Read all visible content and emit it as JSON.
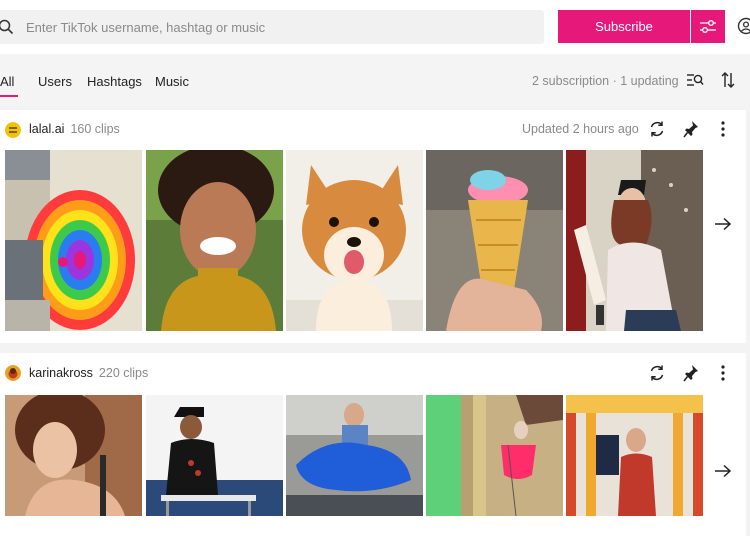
{
  "search": {
    "placeholder": "Enter TikTok username, hashtag or music"
  },
  "subscribe_label": "Subscribe",
  "tabs": [
    {
      "label": "All",
      "active": true
    },
    {
      "label": "Users"
    },
    {
      "label": "Hashtags"
    },
    {
      "label": "Music"
    }
  ],
  "subscription_status": "2 subscription · 1 updating",
  "subscriptions": [
    {
      "username": "lalal.ai",
      "clips": "160 clips",
      "updated": "Updated 2 hours ago",
      "avatar_color": "#f2c200",
      "thumbnails": [
        "rainbow-spiral-painting",
        "smiling-woman-curly-hair",
        "shiba-inu-dog",
        "ice-cream-cone",
        "woman-with-cricket-bat"
      ]
    },
    {
      "username": "karinakross",
      "clips": "220 clips",
      "avatar_color": "#e8a020",
      "thumbnails": [
        "woman-posing-portrait",
        "man-in-black-cap",
        "blue-tarp-slime",
        "pink-bucket-pour",
        "man-on-stage"
      ]
    }
  ],
  "colors": {
    "accent": "#e6197a",
    "muted_text": "#8a8a8a",
    "tab_bar_bg": "#f4f4f4"
  }
}
